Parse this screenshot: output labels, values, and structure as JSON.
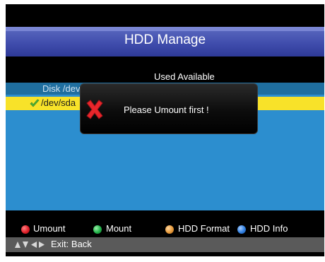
{
  "title": "HDD Manage",
  "columns": {
    "used": "Used",
    "available": "Available"
  },
  "list": {
    "disk_label": "Disk /dev",
    "device_label": "/dev/sda"
  },
  "popup": {
    "message": "Please Umount first !",
    "icon": "error-x-icon"
  },
  "footer": {
    "buttons": [
      {
        "label": "Umount",
        "color": "#e0202a"
      },
      {
        "label": "Mount",
        "color": "#22b34a"
      },
      {
        "label": "HDD Format",
        "color": "#e89a3a"
      },
      {
        "label": "HDD Info",
        "color": "#2f7fe0"
      }
    ],
    "nav_hint": "Exit: Back"
  },
  "colors": {
    "title_bar": "#3e4bab",
    "list_background": "#2c8ecf",
    "selection": "#f8e229",
    "bottom_bar": "#5a5a5a"
  }
}
